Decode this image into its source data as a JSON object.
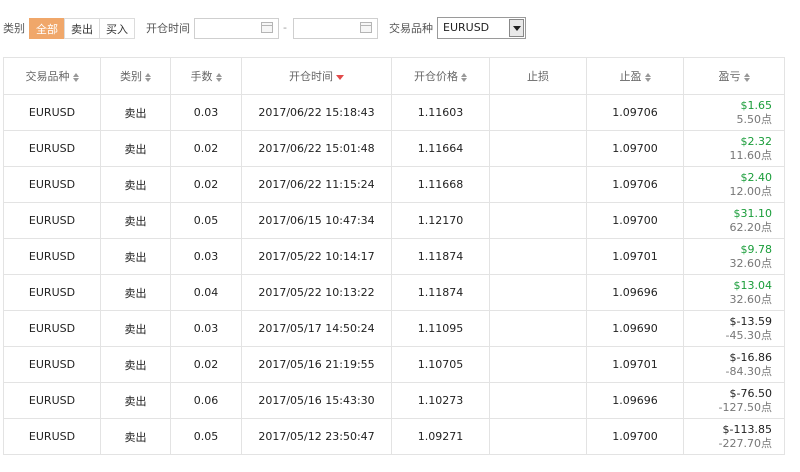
{
  "filters": {
    "category_label": "类别",
    "segments": [
      {
        "label": "全部",
        "active": true
      },
      {
        "label": "卖出",
        "active": false
      },
      {
        "label": "买入",
        "active": false
      }
    ],
    "open_time_label": "开仓时间",
    "date_from": "",
    "date_to": "",
    "date_separator": "-",
    "symbol_label": "交易品种",
    "symbol_selected": "EURUSD"
  },
  "table": {
    "headers": [
      "交易品种",
      "类别",
      "手数",
      "开仓时间",
      "开仓价格",
      "止损",
      "止盈",
      "盈亏"
    ],
    "rows": [
      {
        "symbol": "EURUSD",
        "type": "卖出",
        "lots": "0.03",
        "open_time": "2017/06/22 15:18:43",
        "open_price": "1.11603",
        "sl": "",
        "tp": "1.09706",
        "pnl": "$1.65",
        "points": "5.50点",
        "positive": true
      },
      {
        "symbol": "EURUSD",
        "type": "卖出",
        "lots": "0.02",
        "open_time": "2017/06/22 15:01:48",
        "open_price": "1.11664",
        "sl": "",
        "tp": "1.09700",
        "pnl": "$2.32",
        "points": "11.60点",
        "positive": true
      },
      {
        "symbol": "EURUSD",
        "type": "卖出",
        "lots": "0.02",
        "open_time": "2017/06/22 11:15:24",
        "open_price": "1.11668",
        "sl": "",
        "tp": "1.09706",
        "pnl": "$2.40",
        "points": "12.00点",
        "positive": true
      },
      {
        "symbol": "EURUSD",
        "type": "卖出",
        "lots": "0.05",
        "open_time": "2017/06/15 10:47:34",
        "open_price": "1.12170",
        "sl": "",
        "tp": "1.09700",
        "pnl": "$31.10",
        "points": "62.20点",
        "positive": true
      },
      {
        "symbol": "EURUSD",
        "type": "卖出",
        "lots": "0.03",
        "open_time": "2017/05/22 10:14:17",
        "open_price": "1.11874",
        "sl": "",
        "tp": "1.09701",
        "pnl": "$9.78",
        "points": "32.60点",
        "positive": true
      },
      {
        "symbol": "EURUSD",
        "type": "卖出",
        "lots": "0.04",
        "open_time": "2017/05/22 10:13:22",
        "open_price": "1.11874",
        "sl": "",
        "tp": "1.09696",
        "pnl": "$13.04",
        "points": "32.60点",
        "positive": true
      },
      {
        "symbol": "EURUSD",
        "type": "卖出",
        "lots": "0.03",
        "open_time": "2017/05/17 14:50:24",
        "open_price": "1.11095",
        "sl": "",
        "tp": "1.09690",
        "pnl": "$-13.59",
        "points": "-45.30点",
        "positive": false
      },
      {
        "symbol": "EURUSD",
        "type": "卖出",
        "lots": "0.02",
        "open_time": "2017/05/16 21:19:55",
        "open_price": "1.10705",
        "sl": "",
        "tp": "1.09701",
        "pnl": "$-16.86",
        "points": "-84.30点",
        "positive": false
      },
      {
        "symbol": "EURUSD",
        "type": "卖出",
        "lots": "0.06",
        "open_time": "2017/05/16 15:43:30",
        "open_price": "1.10273",
        "sl": "",
        "tp": "1.09696",
        "pnl": "$-76.50",
        "points": "-127.50点",
        "positive": false
      },
      {
        "symbol": "EURUSD",
        "type": "卖出",
        "lots": "0.05",
        "open_time": "2017/05/12 23:50:47",
        "open_price": "1.09271",
        "sl": "",
        "tp": "1.09700",
        "pnl": "$-113.85",
        "points": "-227.70点",
        "positive": false
      }
    ]
  },
  "colors": {
    "accent": "#f0a76a",
    "sell": "#e04545",
    "profit": "#1a9d3a",
    "sort_active": "#e24b4b"
  }
}
